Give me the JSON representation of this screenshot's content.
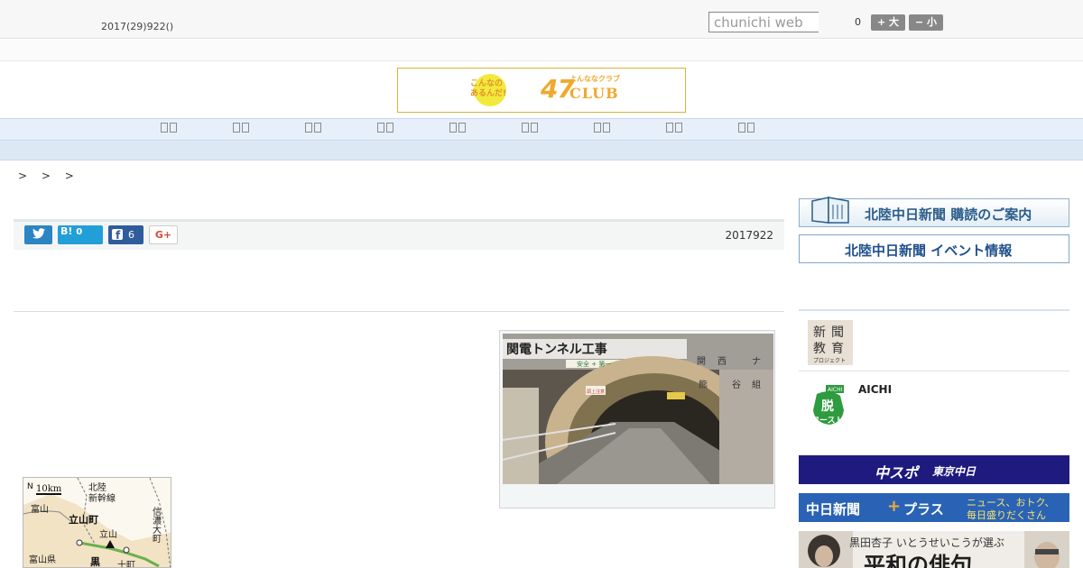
{
  "topbar": {
    "date": "2017(29)922()",
    "search_placeholder": "chunichi web",
    "count": "0",
    "font_large": "+ 大",
    "font_small": "− 小"
  },
  "banner": {
    "sub_line1": "こんなの",
    "sub_line2": "あるんだ!",
    "brand_number": "47",
    "brand_kana": "よんななクラブ",
    "brand_word": "CLUB"
  },
  "nav": {
    "item_count": 9
  },
  "breadcrumb": "> > >",
  "article": {
    "share_twitter_count": "",
    "share_hatena_label": "B!",
    "share_hatena_count": "0",
    "share_facebook_count": "6",
    "share_google_label": "G+",
    "date": "2017922"
  },
  "photo": {
    "sign_text": "関電トンネル工事",
    "sign_safety": "安全 + 第一",
    "side_kanji": [
      "関",
      "西",
      "ナ",
      "熊",
      "谷",
      "組"
    ],
    "small_sign": "頭上注意"
  },
  "map": {
    "scale": "10km",
    "north": "N",
    "labels": [
      "北陸",
      "新幹線",
      "富山",
      "立山町",
      "立山",
      "信濃大町",
      "富山県",
      "黒",
      "十町"
    ]
  },
  "sidebar": {
    "subscribe_label": "北陸中日新聞 購読のご案内",
    "event_label": "北陸中日新聞 イベント情報",
    "edu_icon_text": [
      "新",
      "聞",
      "教",
      "育",
      "プロジェクト"
    ],
    "edu_label": "",
    "aichi_label": "AICHI",
    "aichi_icon_text": [
      "AICHI",
      "脱",
      "ワースト"
    ]
  },
  "ads": {
    "chuspo_text": "中スポ",
    "tokyo_text": "東京中日",
    "plus_name": "中日新聞",
    "plus_word": "プラス",
    "plus_tag1": "ニュース、おトク、",
    "plus_tag2": "毎日盛りだくさん",
    "haiku_author": "黒田杏子  いとうせいこうが選ぶ",
    "haiku_title": "平和の俳句"
  },
  "colors": {
    "nav_bg": "#e7f0fa",
    "twitter": "#2b85c2",
    "hatena": "#229fd9",
    "facebook": "#2f5d9c",
    "banner_accent": "#efa92d"
  }
}
